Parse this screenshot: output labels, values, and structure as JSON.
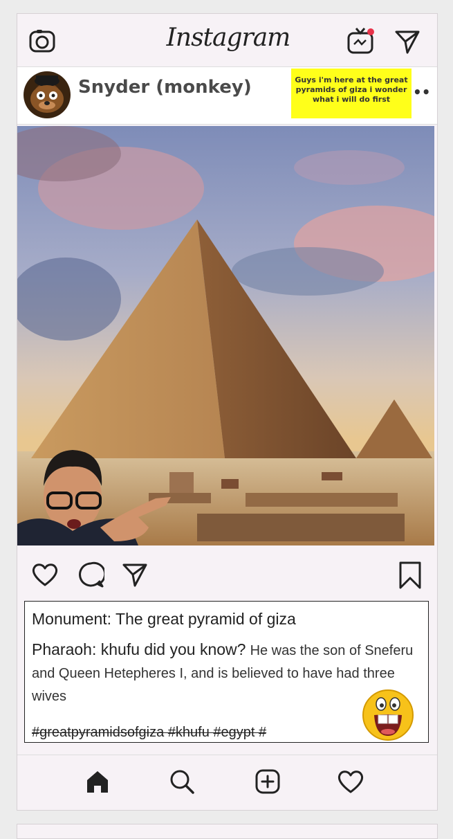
{
  "app": {
    "logo_text": "Instagram"
  },
  "topbar": {
    "icons": [
      "camera-icon",
      "igtv-icon",
      "direct-message-icon"
    ],
    "notification_dot_color": "#e8334a"
  },
  "post": {
    "username": "Snyder (monkey)",
    "note_text": "Guys i'm here at the great pyramids of giza i wonder what i will do first",
    "note_color": "#ffff1a",
    "more_label": "••",
    "photo_alt": "The Great Pyramid of Giza with a person pointing"
  },
  "actions": {
    "icons": [
      "heart-icon",
      "comment-icon",
      "share-icon",
      "bookmark-icon"
    ]
  },
  "caption": {
    "monument": "Monument: The great pyramid of giza",
    "fact_lead": "Pharaoh: khufu did you know?",
    "fact_body": "He was the son of Sneferu and Queen Hetepheres I, and is believed to have had three wives",
    "hashtags": "#greatpyramidsofgiza #khufu #egypt #"
  },
  "bottom_nav": {
    "icons": [
      "home-icon",
      "search-icon",
      "new-post-icon",
      "activity-heart-icon"
    ]
  }
}
